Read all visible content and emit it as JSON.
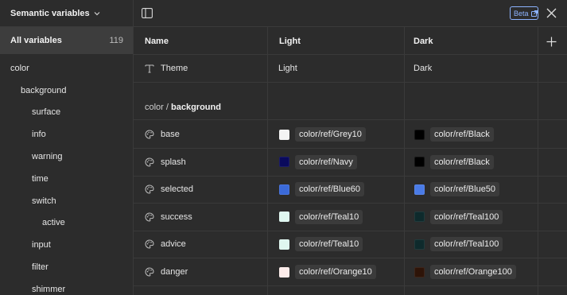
{
  "sidebar": {
    "title": "Semantic variables",
    "all_label": "All variables",
    "all_count": "119",
    "tree": [
      {
        "label": "color",
        "level": 0
      },
      {
        "label": "background",
        "level": 1
      },
      {
        "label": "surface",
        "level": 2
      },
      {
        "label": "info",
        "level": 2
      },
      {
        "label": "warning",
        "level": 2
      },
      {
        "label": "time",
        "level": 2
      },
      {
        "label": "switch",
        "level": 2
      },
      {
        "label": "active",
        "level": 3
      },
      {
        "label": "input",
        "level": 2
      },
      {
        "label": "filter",
        "level": 2
      },
      {
        "label": "shimmer",
        "level": 2
      }
    ]
  },
  "topbar": {
    "beta_label": "Beta"
  },
  "table": {
    "columns": {
      "name": "Name",
      "light": "Light",
      "dark": "Dark"
    },
    "theme_row": {
      "name": "Theme",
      "light": "Light",
      "dark": "Dark"
    },
    "group": {
      "prefix": "color / ",
      "name": "background"
    },
    "rows": [
      {
        "name": "base",
        "light": "color/ref/Grey10",
        "light_color": "#f4f4f4",
        "dark": "color/ref/Black",
        "dark_color": "#000000"
      },
      {
        "name": "splash",
        "light": "color/ref/Navy",
        "light_color": "#0a0a5c",
        "dark": "color/ref/Black",
        "dark_color": "#000000"
      },
      {
        "name": "selected",
        "light": "color/ref/Blue60",
        "light_color": "#3b6ad9",
        "dark": "color/ref/Blue50",
        "dark_color": "#4a7be6"
      },
      {
        "name": "success",
        "light": "color/ref/Teal10",
        "light_color": "#dff7f0",
        "dark": "color/ref/Teal100",
        "dark_color": "#0e2a2c"
      },
      {
        "name": "advice",
        "light": "color/ref/Teal10",
        "light_color": "#dff7f0",
        "dark": "color/ref/Teal100",
        "dark_color": "#0e2a2c"
      },
      {
        "name": "danger",
        "light": "color/ref/Orange10",
        "light_color": "#fcecea",
        "dark": "color/ref/Orange100",
        "dark_color": "#2e1408"
      }
    ]
  }
}
